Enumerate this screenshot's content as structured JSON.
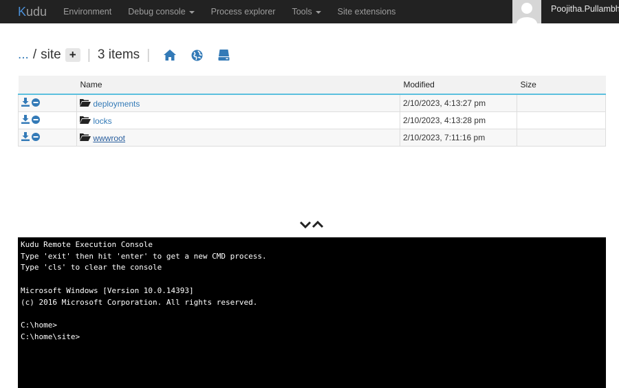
{
  "navbar": {
    "brand_k": "K",
    "brand_rest": "udu",
    "items": [
      "Environment",
      "Debug console",
      "Process explorer",
      "Tools",
      "Site extensions"
    ],
    "user_name": "Poojitha.Pullambha"
  },
  "breadcrumb": {
    "parent": "...",
    "slash": "/",
    "current": "site",
    "add": "+",
    "sep": "|",
    "count": "3 items"
  },
  "table": {
    "headers": {
      "name": "Name",
      "modified": "Modified",
      "size": "Size"
    },
    "rows": [
      {
        "name": "deployments",
        "modified": "2/10/2023, 4:13:27 pm",
        "size": ""
      },
      {
        "name": "locks",
        "modified": "2/10/2023, 4:13:28 pm",
        "size": ""
      },
      {
        "name": "wwwroot",
        "modified": "2/10/2023, 7:11:16 pm",
        "size": ""
      }
    ]
  },
  "console": {
    "text": "Kudu Remote Execution Console\nType 'exit' then hit 'enter' to get a new CMD process.\nType 'cls' to clear the console\n\nMicrosoft Windows [Version 10.0.14393]\n(c) 2016 Microsoft Corporation. All rights reserved.\n\nC:\\home>\nC:\\home\\site>"
  },
  "icons": {
    "download": "download-icon",
    "delete": "remove-circle-icon",
    "folder": "folder-open-icon",
    "home": "home-icon",
    "globe": "globe-icon",
    "drive": "hard-drive-icon",
    "resize": "chevron-down-up-icon"
  },
  "colors": {
    "link": "#337ab7",
    "navbar": "#222222",
    "header_border": "#5bc0de"
  }
}
